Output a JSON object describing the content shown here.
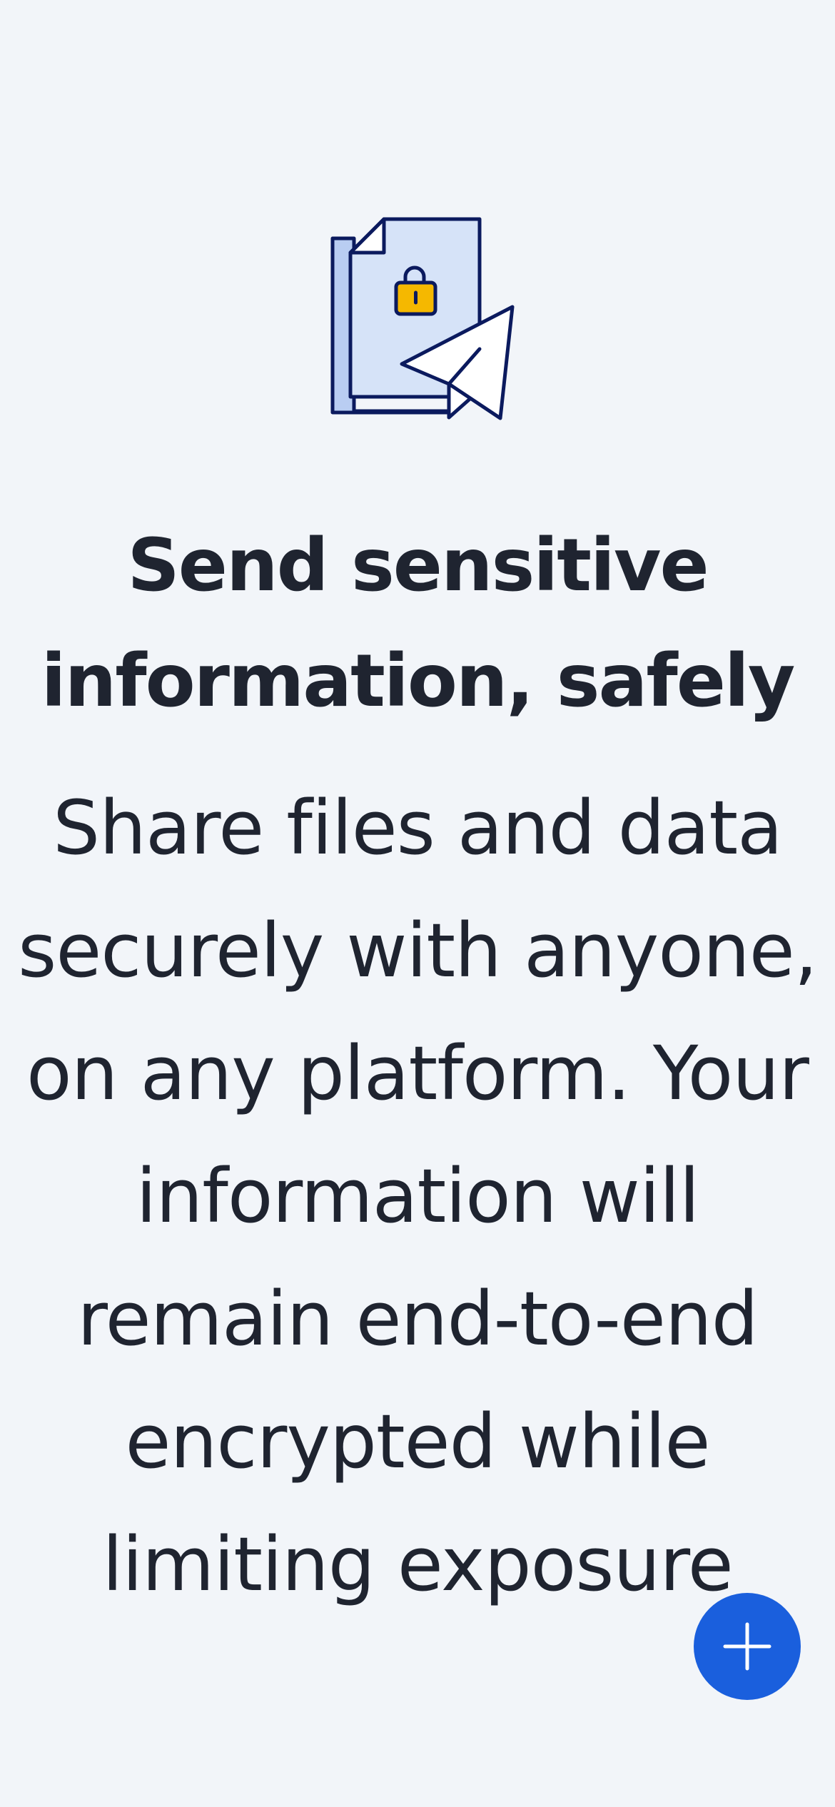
{
  "empty_state": {
    "illustration_icon": "locked-document-send-icon",
    "title": "Send sensitive information, safely",
    "description": "Share files and data securely with anyone, on any platform. Your information will remain end-to-end encrypted while limiting exposure"
  },
  "fab": {
    "icon": "plus-icon",
    "color": "#1a5fdd"
  },
  "colors": {
    "background": "#f2f5f9",
    "text": "#1f2430",
    "illustration_outline": "#0b1a5e",
    "illustration_fill": "#d6e3f8",
    "lock": "#f5b800"
  }
}
